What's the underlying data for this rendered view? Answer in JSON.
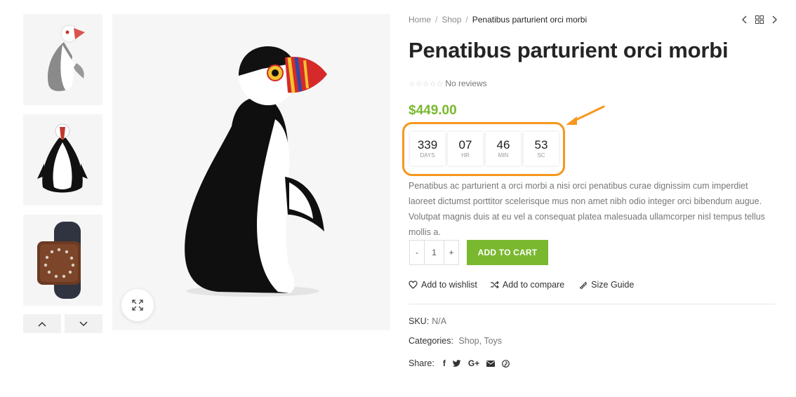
{
  "breadcrumb": {
    "home": "Home",
    "shop": "Shop",
    "current": "Penatibus parturient orci morbi"
  },
  "product": {
    "title": "Penatibus parturient orci morbi",
    "reviews": "No reviews",
    "price": "$449.00",
    "description": "Penatibus ac parturient a orci morbi a nisi orci penatibus curae dignissim cum imperdiet laoreet dictumst porttitor scelerisque mus non amet nibh odio integer orci bibendum augue. Volutpat magnis duis at eu vel a consequat platea malesuada ullamcorper nisl tempus tellus mollis a."
  },
  "countdown": {
    "days": "339",
    "days_label": "DAYS",
    "hours": "07",
    "hours_label": "HR",
    "minutes": "46",
    "minutes_label": "MIN",
    "seconds": "53",
    "seconds_label": "SC"
  },
  "cart": {
    "minus": "-",
    "quantity": "1",
    "plus": "+",
    "add_label": "ADD TO CART"
  },
  "actions": {
    "wishlist": "Add to wishlist",
    "compare": "Add to compare",
    "size_guide": "Size Guide"
  },
  "meta": {
    "sku_label": "SKU:",
    "sku_value": "N/A",
    "categories_label": "Categories:",
    "category_1": "Shop",
    "category_sep": ",",
    "category_2": "Toys",
    "share_label": "Share:"
  },
  "share": {
    "facebook": "f",
    "google": "G+"
  },
  "colors": {
    "accent": "#7ab82f",
    "highlight": "#f7971e"
  },
  "icons": [
    "chevron-left-icon",
    "grid-icon",
    "chevron-right-icon",
    "expand-icon",
    "heart-icon",
    "shuffle-icon",
    "ruler-icon",
    "facebook-icon",
    "twitter-icon",
    "google-plus-icon",
    "mail-icon",
    "pinterest-icon",
    "chevron-up-icon",
    "chevron-down-icon"
  ]
}
